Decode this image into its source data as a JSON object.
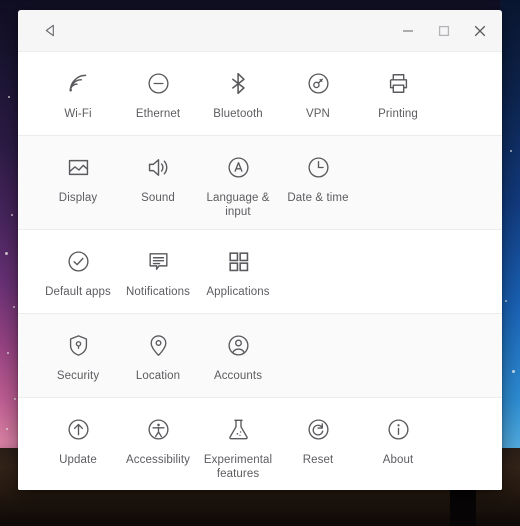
{
  "titlebar": {
    "back_label": "Back",
    "minimize_label": "Minimize",
    "maximize_label": "Maximize",
    "close_label": "Close"
  },
  "settings": {
    "rows": [
      {
        "tiles": [
          {
            "icon": "wifi-icon",
            "label": "Wi-Fi"
          },
          {
            "icon": "ethernet-icon",
            "label": "Ethernet"
          },
          {
            "icon": "bluetooth-icon",
            "label": "Bluetooth"
          },
          {
            "icon": "vpn-key-icon",
            "label": "VPN"
          },
          {
            "icon": "printer-icon",
            "label": "Printing"
          }
        ]
      },
      {
        "tiles": [
          {
            "icon": "display-icon",
            "label": "Display"
          },
          {
            "icon": "sound-icon",
            "label": "Sound"
          },
          {
            "icon": "language-icon",
            "label": "Language & input"
          },
          {
            "icon": "clock-icon",
            "label": "Date & time"
          }
        ]
      },
      {
        "tiles": [
          {
            "icon": "check-circle-icon",
            "label": "Default apps"
          },
          {
            "icon": "notification-icon",
            "label": "Notifications"
          },
          {
            "icon": "grid-icon",
            "label": "Applications"
          }
        ]
      },
      {
        "tiles": [
          {
            "icon": "shield-icon",
            "label": "Security"
          },
          {
            "icon": "location-icon",
            "label": "Location"
          },
          {
            "icon": "account-icon",
            "label": "Accounts"
          }
        ]
      },
      {
        "tiles": [
          {
            "icon": "update-icon",
            "label": "Update"
          },
          {
            "icon": "accessibility-icon",
            "label": "Accessibility"
          },
          {
            "icon": "flask-icon",
            "label": "Experimental features"
          },
          {
            "icon": "reset-icon",
            "label": "Reset"
          },
          {
            "icon": "info-icon",
            "label": "About"
          }
        ]
      }
    ]
  },
  "colors": {
    "icon": "#5a5a5e",
    "label": "#5c5c61",
    "titlebar_bg": "#f6f6f7",
    "panel_bg": "#ffffff",
    "panel_alt_bg": "#fafafa",
    "divider": "#ededee"
  }
}
